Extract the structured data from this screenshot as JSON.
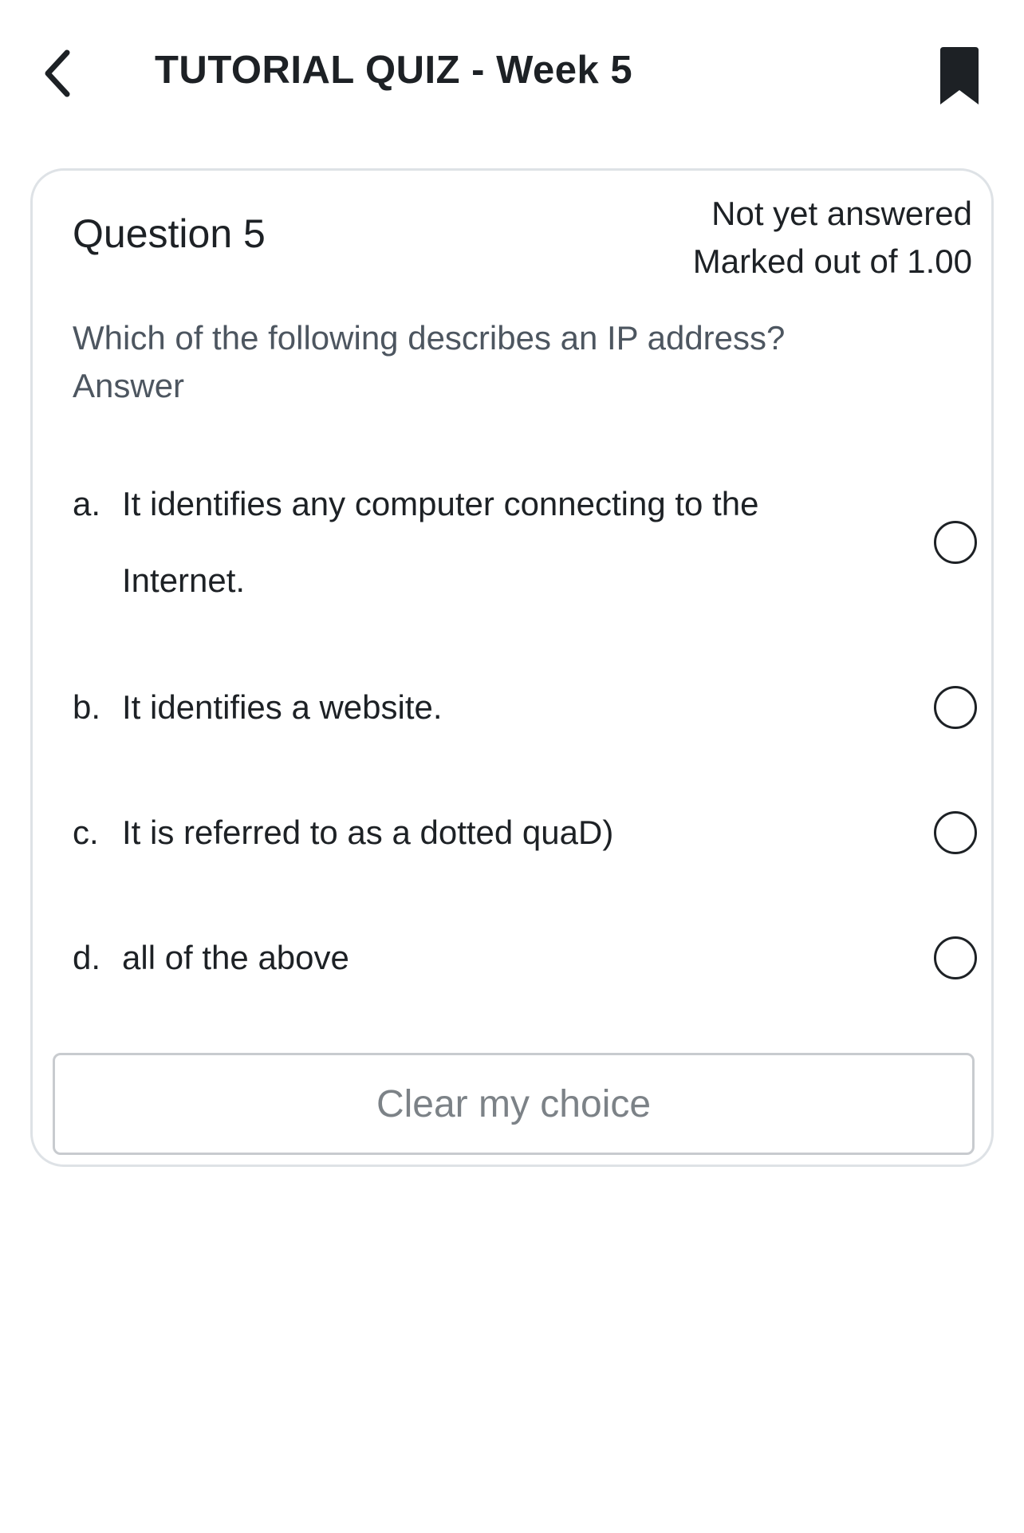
{
  "header": {
    "title": "TUTORIAL QUIZ - Week 5",
    "back_icon": "chevron-left-icon",
    "bookmark_icon": "bookmark-icon"
  },
  "question": {
    "number_label": "Question 5",
    "status": "Not yet answered",
    "marks": "Marked out of 1.00",
    "text": "Which of the following describes an IP address?",
    "answer_label": "Answer",
    "options": [
      {
        "letter": "a.",
        "text": "It identifies any computer connecting to the Internet.",
        "selected": false
      },
      {
        "letter": "b.",
        "text": "It identifies a website.",
        "selected": false
      },
      {
        "letter": "c.",
        "text": "It is referred to as a dotted quaD)",
        "selected": false
      },
      {
        "letter": "d.",
        "text": "all of the above",
        "selected": false
      }
    ],
    "clear_label": "Clear my choice"
  },
  "colors": {
    "text": "#1d2125",
    "muted_text": "#4d5660",
    "card_border": "#dee2e6",
    "button_text": "#7c8287"
  }
}
